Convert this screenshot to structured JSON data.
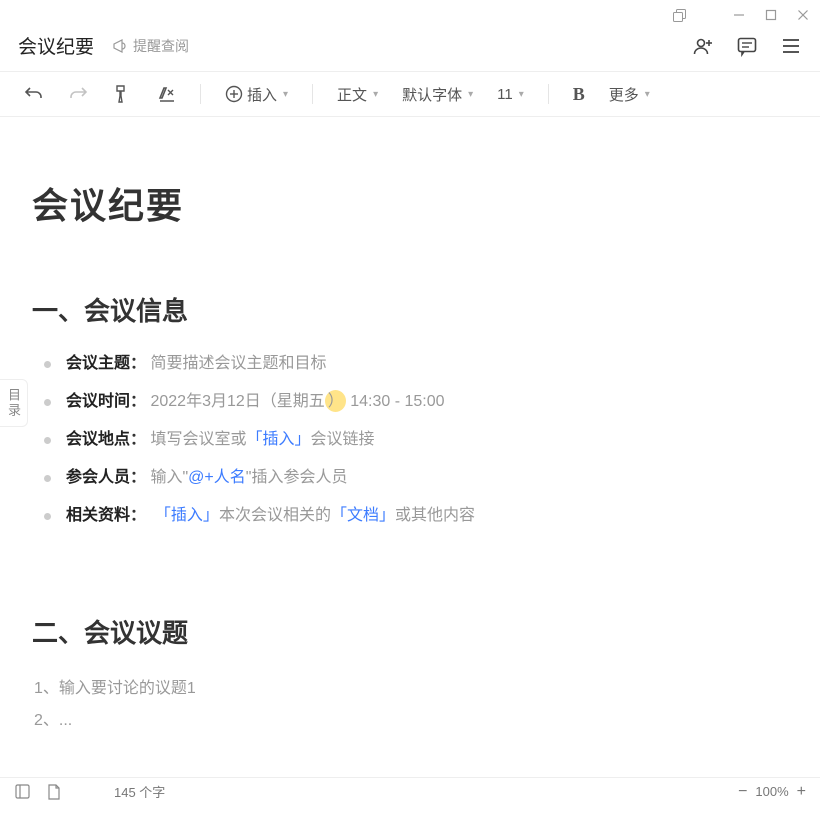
{
  "header": {
    "title": "会议纪要",
    "remind": "提醒查阅"
  },
  "toolbar": {
    "insert": "插入",
    "body_style": "正文",
    "default_font": "默认字体",
    "font_size": "11",
    "more": "更多"
  },
  "outline": "目录",
  "document": {
    "title": "会议纪要",
    "section1_heading": "一、会议信息",
    "info": {
      "topic_label": "会议主题",
      "topic_placeholder": "简要描述会议主题和目标",
      "time_label": "会议时间",
      "time_value_before": "2022年3月12日（星期五",
      "time_value_cursor": "）",
      "time_value_after": "14:30 - 15:00",
      "venue_label": "会议地点",
      "venue_placeholder_1": "填写会议室或",
      "venue_link": "「插入」",
      "venue_placeholder_2": "会议链接",
      "attendee_label": "参会人员",
      "attendee_placeholder_1": "输入\"",
      "attendee_link": "@+人名",
      "attendee_placeholder_2": "\"插入参会人员",
      "materials_label": "相关资料",
      "materials_link1": "「插入」",
      "materials_text1": "本次会议相关的",
      "materials_link2": "「文档」",
      "materials_text2": "或其他内容"
    },
    "section2_heading": "二、会议议题",
    "topics": {
      "line1_prefix": "1、",
      "line1_text": "输入要讨论的议题1",
      "line2_prefix": "2、",
      "line2_text": "..."
    }
  },
  "statusbar": {
    "word_count": "145 个字",
    "zoom": "100%"
  }
}
